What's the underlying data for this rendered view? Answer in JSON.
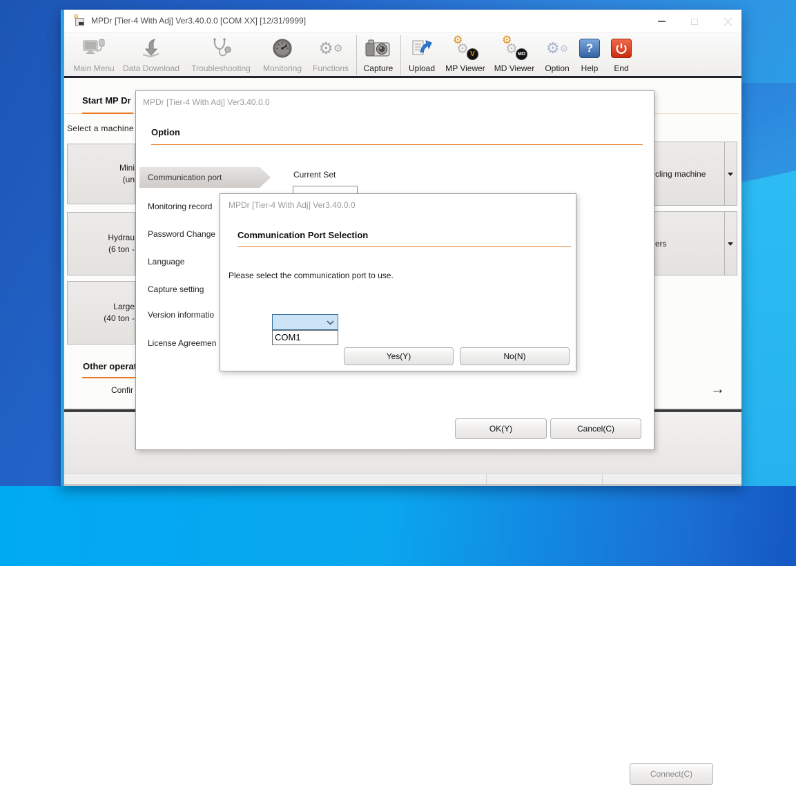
{
  "window": {
    "title": "MPDr [Tier-4 With Adj] Ver3.40.0.0 [COM XX] [12/31/9999]"
  },
  "toolbar": {
    "items": [
      {
        "label": "Main Menu",
        "enabled": false
      },
      {
        "label": "Data Download",
        "enabled": false
      },
      {
        "label": "Troubleshooting",
        "enabled": false
      },
      {
        "label": "Monitoring",
        "enabled": false
      },
      {
        "label": "Functions",
        "enabled": false
      },
      {
        "label": "Capture",
        "enabled": true
      },
      {
        "label": "Upload",
        "enabled": true
      },
      {
        "label": "MP Viewer",
        "enabled": true
      },
      {
        "label": "MD Viewer",
        "enabled": true
      },
      {
        "label": "Option",
        "enabled": true
      },
      {
        "label": "Help",
        "enabled": true
      },
      {
        "label": "End",
        "enabled": true
      }
    ]
  },
  "icons": {
    "gear": "⚙",
    "help_question": "?",
    "mp_badge": "V",
    "md_badge": "MD"
  },
  "main": {
    "tab_label": "Start MP Dr",
    "select_machine_label": "Select a machine",
    "left_buttons": [
      {
        "line1": "Mini",
        "line2": "(un"
      },
      {
        "line1": "Hydrau",
        "line2": "(6 ton -"
      },
      {
        "line1": "Large",
        "line2": "(40 ton -"
      }
    ],
    "right_buttons": [
      {
        "label": "cling machine"
      },
      {
        "label": "ers"
      }
    ],
    "other_operations_label": "Other operat",
    "confirm_label": "Confir",
    "arrow_glyph": "→",
    "connect_button_label": "Connect(C)"
  },
  "option_dialog": {
    "title": "MPDr [Tier-4 With Adj] Ver3.40.0.0",
    "heading": "Option",
    "nav_items": [
      "Communication port",
      "Monitoring record",
      "Password Change",
      "Language",
      "Capture setting",
      "Version informatio",
      "License Agreemen"
    ],
    "current_set_label": "Current Set",
    "ok_label": "OK(Y)",
    "cancel_label": "Cancel(C)"
  },
  "port_dialog": {
    "title": "MPDr [Tier-4 With Adj] Ver3.40.0.0",
    "heading": "Communication Port Selection",
    "message": "Please select the communication port to use.",
    "combo_value": "",
    "options": [
      "COM1"
    ],
    "yes_label": "Yes(Y)",
    "no_label": "No(N)"
  },
  "colors": {
    "accent_orange": "#e87722",
    "window_border_blue": "#2aa6e6",
    "combo_selection_fill": "#cce4f7",
    "combo_border": "#39719e",
    "help_blue": "#33629f",
    "end_red": "#c92d0e"
  }
}
